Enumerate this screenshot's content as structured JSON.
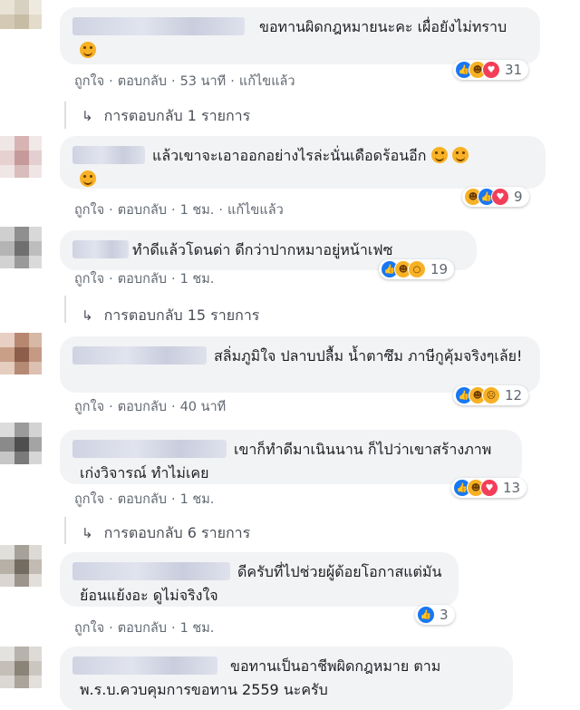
{
  "comments": [
    {
      "text": "ขอทานผิดกฎหมายนะคะ เผื่อยังไม่ทราบ",
      "emoji": "smirk-face-emoji",
      "actions": {
        "like": "ถูกใจ",
        "reply": "ตอบกลับ",
        "time": "53 นาที",
        "edited": "แก้ไขแล้ว"
      },
      "reactions": [
        "like",
        "haha",
        "love"
      ],
      "reaction_count": "31",
      "replies_label": "การตอบกลับ 1 รายการ"
    },
    {
      "text": "แล้วเขาจะเอาออกอย่างไรล่ะนั่นเดือดร้อนอีก",
      "emoji": "laughing-face-emoji",
      "actions": {
        "like": "ถูกใจ",
        "reply": "ตอบกลับ",
        "time": "1 ชม.",
        "edited": "แก้ไขแล้ว"
      },
      "reactions": [
        "haha",
        "like",
        "love"
      ],
      "reaction_count": "9"
    },
    {
      "text": "ทำดีแล้วโดนด่า ดีกว่าปากหมาอยู่หน้าเฟซ",
      "actions": {
        "like": "ถูกใจ",
        "reply": "ตอบกลับ",
        "time": "1 ชม."
      },
      "reactions": [
        "like",
        "haha",
        "wow"
      ],
      "reaction_count": "19",
      "replies_label": "การตอบกลับ 15 รายการ"
    },
    {
      "text": "สลิ่มภูมิใจ ปลาบปลื้ม น้ำตาซึม ภาษีกูคุ้มจริงๆเล้ย!",
      "actions": {
        "like": "ถูกใจ",
        "reply": "ตอบกลับ",
        "time": "40 นาที"
      },
      "reactions": [
        "like",
        "haha",
        "sad"
      ],
      "reaction_count": "12"
    },
    {
      "text": "เขาก็ทำดีมาเนินนาน ก็ไปว่าเขาสร้างภาพ เก่งวิจารณ์ ทำไม่เคย",
      "actions": {
        "like": "ถูกใจ",
        "reply": "ตอบกลับ",
        "time": "1 ชม."
      },
      "reactions": [
        "like",
        "haha",
        "love"
      ],
      "reaction_count": "13",
      "replies_label": "การตอบกลับ 6 รายการ"
    },
    {
      "text": "ดีครับที่ไปช่วยผู้ด้อยโอกาสแต่มันย้อนแย้งอะ ดูไม่จริงใจ",
      "actions": {
        "like": "ถูกใจ",
        "reply": "ตอบกลับ",
        "time": "1 ชม."
      },
      "reactions": [
        "like"
      ],
      "reaction_count": "3"
    },
    {
      "text": "ขอทานเป็นอาชีพผิดกฎหมาย ตาม พ.ร.บ.ควบคุมการขอทาน 2559 นะครับ",
      "actions": {},
      "reactions": []
    }
  ],
  "colors": {
    "like": "#1877f2",
    "haha": "#f7b125",
    "love": "#f33e58",
    "bubble": "#f2f3f5",
    "meta": "#606770"
  }
}
